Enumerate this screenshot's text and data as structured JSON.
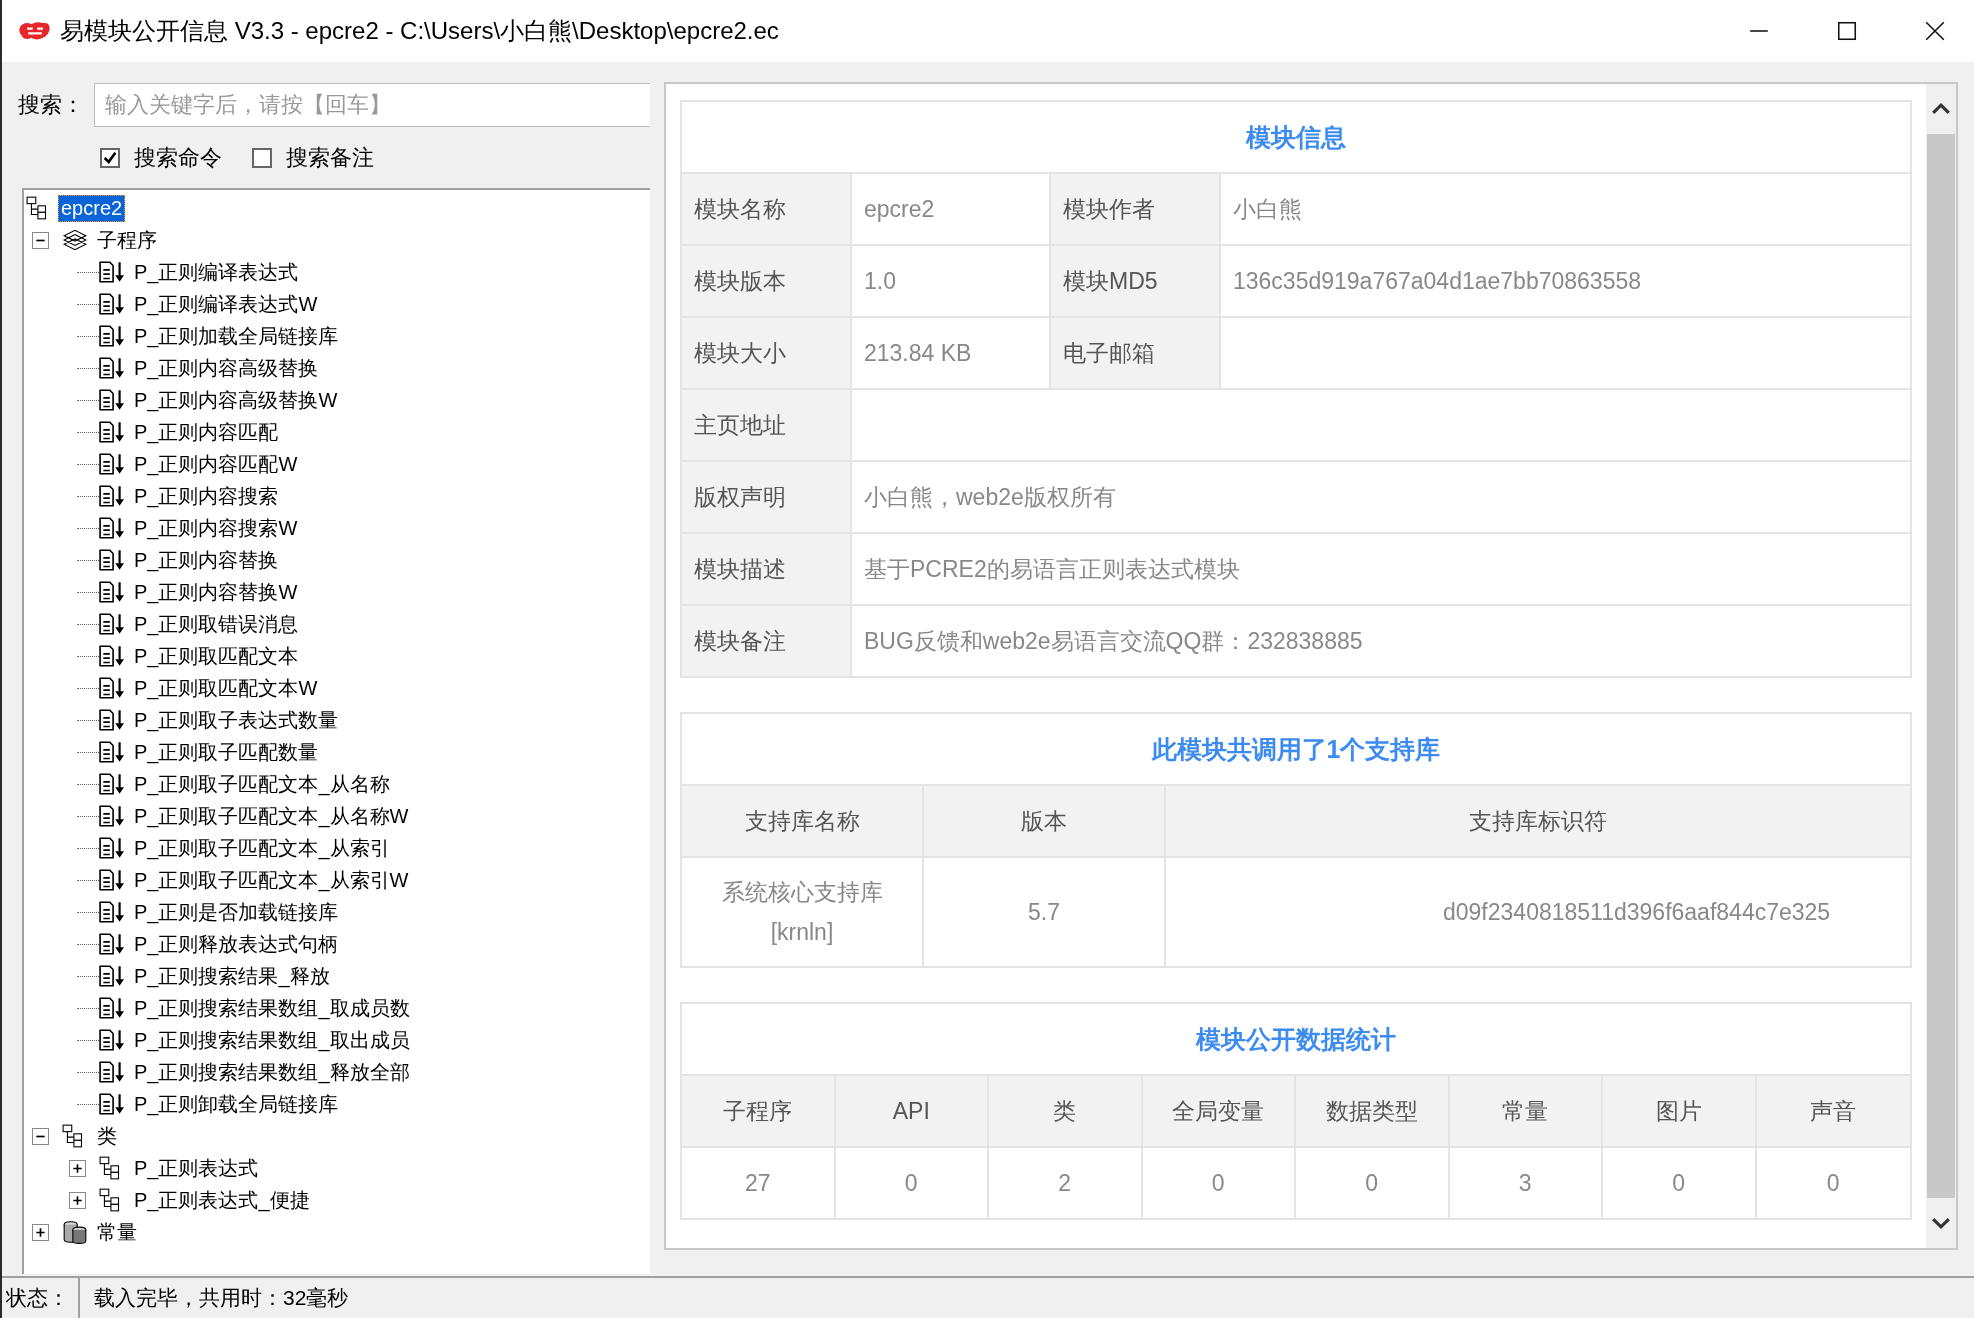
{
  "window": {
    "title": "易模块公开信息 V3.3 - epcre2 - C:\\Users\\小白熊\\Desktop\\epcre2.ec"
  },
  "search": {
    "label": "搜索：",
    "placeholder": "输入关键字后，请按【回车】"
  },
  "options": [
    {
      "label": "搜索命令",
      "checked": true
    },
    {
      "label": "搜索备注",
      "checked": false
    }
  ],
  "tree": {
    "items": [
      {
        "label": "epcre2",
        "kind": "module",
        "selected": true,
        "children": [
          {
            "label": "子程序",
            "kind": "folder",
            "selected": false,
            "expanded": true,
            "children": [
              {
                "label": "P_正则编译表达式",
                "kind": "sub",
                "selected": false
              },
              {
                "label": "P_正则编译表达式W",
                "kind": "sub",
                "selected": false
              },
              {
                "label": "P_正则加载全局链接库",
                "kind": "sub",
                "selected": false
              },
              {
                "label": "P_正则内容高级替换",
                "kind": "sub",
                "selected": false
              },
              {
                "label": "P_正则内容高级替换W",
                "kind": "sub",
                "selected": false
              },
              {
                "label": "P_正则内容匹配",
                "kind": "sub",
                "selected": false
              },
              {
                "label": "P_正则内容匹配W",
                "kind": "sub",
                "selected": false
              },
              {
                "label": "P_正则内容搜索",
                "kind": "sub",
                "selected": false
              },
              {
                "label": "P_正则内容搜索W",
                "kind": "sub",
                "selected": false
              },
              {
                "label": "P_正则内容替换",
                "kind": "sub",
                "selected": false
              },
              {
                "label": "P_正则内容替换W",
                "kind": "sub",
                "selected": false
              },
              {
                "label": "P_正则取错误消息",
                "kind": "sub",
                "selected": false
              },
              {
                "label": "P_正则取匹配文本",
                "kind": "sub",
                "selected": false
              },
              {
                "label": "P_正则取匹配文本W",
                "kind": "sub",
                "selected": false
              },
              {
                "label": "P_正则取子表达式数量",
                "kind": "sub",
                "selected": false
              },
              {
                "label": "P_正则取子匹配数量",
                "kind": "sub",
                "selected": false
              },
              {
                "label": "P_正则取子匹配文本_从名称",
                "kind": "sub",
                "selected": false
              },
              {
                "label": "P_正则取子匹配文本_从名称W",
                "kind": "sub",
                "selected": false
              },
              {
                "label": "P_正则取子匹配文本_从索引",
                "kind": "sub",
                "selected": false
              },
              {
                "label": "P_正则取子匹配文本_从索引W",
                "kind": "sub",
                "selected": false
              },
              {
                "label": "P_正则是否加载链接库",
                "kind": "sub",
                "selected": false
              },
              {
                "label": "P_正则释放表达式句柄",
                "kind": "sub",
                "selected": false
              },
              {
                "label": "P_正则搜索结果_释放",
                "kind": "sub",
                "selected": false
              },
              {
                "label": "P_正则搜索结果数组_取成员数",
                "kind": "sub",
                "selected": false
              },
              {
                "label": "P_正则搜索结果数组_取出成员",
                "kind": "sub",
                "selected": false
              },
              {
                "label": "P_正则搜索结果数组_释放全部",
                "kind": "sub",
                "selected": false
              },
              {
                "label": "P_正则卸载全局链接库",
                "kind": "sub",
                "selected": false
              }
            ]
          },
          {
            "label": "类",
            "kind": "class",
            "selected": false,
            "expanded": true,
            "children": [
              {
                "label": "P_正则表达式",
                "kind": "class",
                "selected": false,
                "expanded": false
              },
              {
                "label": "P_正则表达式_便捷",
                "kind": "class",
                "selected": false,
                "expanded": false
              }
            ]
          },
          {
            "label": "常量",
            "kind": "constant",
            "selected": false,
            "expanded": false
          }
        ]
      }
    ]
  },
  "info": {
    "title": "模块信息",
    "rows": [
      [
        {
          "label": "模块名称",
          "value": "epcre2"
        },
        {
          "label": "模块作者",
          "value": "小白熊"
        }
      ],
      [
        {
          "label": "模块版本",
          "value": "1.0"
        },
        {
          "label": "模块MD5",
          "value": "136c35d919a767a04d1ae7bb70863558"
        }
      ],
      [
        {
          "label": "模块大小",
          "value": "213.84 KB"
        },
        {
          "label": "电子邮箱"
        }
      ],
      [
        {
          "label": "主页地址"
        }
      ],
      [
        {
          "label": "版权声明",
          "value": "小白熊，web2e版权所有"
        }
      ],
      [
        {
          "label": "模块描述",
          "value": "基于PCRE2的易语言正则表达式模块"
        }
      ],
      [
        {
          "label": "模块备注",
          "value": "BUG反馈和web2e易语言交流QQ群：232838885"
        }
      ]
    ]
  },
  "libraries": {
    "title": "此模块共调用了1个支持库",
    "columns": [
      "支持库名称",
      "版本",
      "支持库标识符"
    ],
    "rows": [
      [
        "系统核心支持库 [krnln]",
        "5.7",
        "d09f2340818511d396f6aaf844c7e325"
      ]
    ]
  },
  "stats": {
    "title": "模块公开数据统计",
    "columns": [
      "子程序",
      "API",
      "类",
      "全局变量",
      "数据类型",
      "常量",
      "图片",
      "声音"
    ],
    "values": [
      "27",
      "0",
      "2",
      "0",
      "0",
      "3",
      "0",
      "0"
    ]
  },
  "status_bar": {
    "label": "状态：",
    "text": "载入完毕，共用时：32毫秒"
  }
}
